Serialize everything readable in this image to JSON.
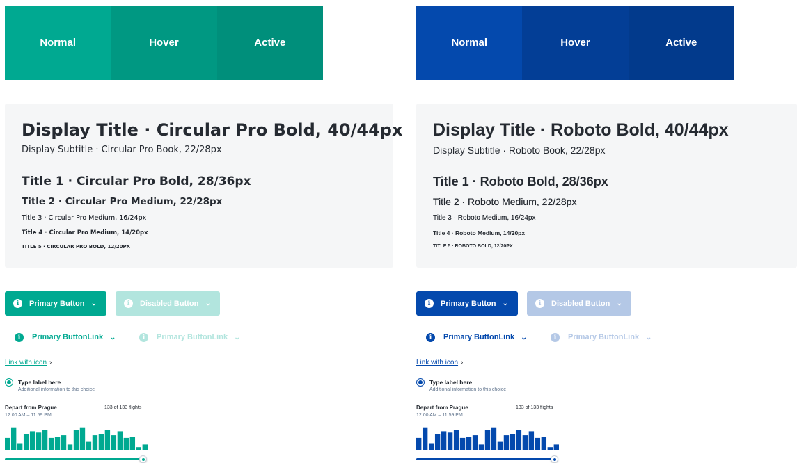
{
  "themes": [
    {
      "id": "green",
      "colors": {
        "normal": "#00a991",
        "hover": "#009882",
        "active": "#008f7b",
        "disabled": "#b2e5de",
        "text": "#00a991",
        "muted": "#b2e5de"
      },
      "swatches": {
        "normal": "Normal",
        "hover": "Hover",
        "active": "Active"
      },
      "typography": {
        "display": "Display Title · Circular Pro Bold, 40/44px",
        "subtitle": "Display Subtitle · Circular Pro Book, 22/28px",
        "title1": "Title 1 · Circular Pro Bold, 28/36px",
        "title2": "Title 2 · Circular Pro Medium, 22/28px",
        "title3": "Title 3 · Circular Pro Medium, 16/24px",
        "title4": "Title 4 · Circular Pro Medium, 14/20px",
        "title5": "TITLE 5 · CIRCULAR PRO BOLD, 12/20PX"
      },
      "buttons": {
        "primary": "Primary Button",
        "disabled": "Disabled Button",
        "primary_link": "Primary ButtonLink",
        "disabled_link": "Primary ButtonLink"
      },
      "link": "Link with icon",
      "radio": {
        "label": "Type label here",
        "help": "Additional information to this choice",
        "checked": true
      },
      "slider": {
        "title": "Depart from Prague",
        "time": "12:00 AM – 11:59 PM",
        "count": "133 of 133 flights",
        "value": 1.0
      }
    },
    {
      "id": "blue",
      "colors": {
        "normal": "#0449ad",
        "hover": "#033e96",
        "active": "#023a8c",
        "disabled": "#b4c8e6",
        "text": "#0449ad",
        "muted": "#b4c8e6"
      },
      "swatches": {
        "normal": "Normal",
        "hover": "Hover",
        "active": "Active"
      },
      "typography": {
        "display": "Display Title · Roboto Bold, 40/44px",
        "subtitle": "Display Subtitle · Roboto Book, 22/28px",
        "title1": "Title 1 · Roboto Bold, 28/36px",
        "title2": "Title 2 · Roboto Medium, 22/28px",
        "title3": "Title 3 · Roboto Medium, 16/24px",
        "title4": "Title 4 · Roboto Medium, 14/20px",
        "title5": "TITLE 5 · ROBOTO BOLD, 12/20PX"
      },
      "buttons": {
        "primary": "Primary Button",
        "disabled": "Disabled Button",
        "primary_link": "Primary ButtonLink",
        "disabled_link": "Primary ButtonLink"
      },
      "link": "Link with icon",
      "radio": {
        "label": "Type label here",
        "help": "Additional information to this choice",
        "checked": true
      },
      "slider": {
        "title": "Depart from Prague",
        "time": "12:00 AM – 11:59 PM",
        "count": "133 of 133 flights",
        "value": 1.0
      }
    }
  ],
  "histogram": [
    0.45,
    0.85,
    0.25,
    0.6,
    0.7,
    0.65,
    0.75,
    0.45,
    0.5,
    0.55,
    0.2,
    0.75,
    0.85,
    0.3,
    0.55,
    0.6,
    0.75,
    0.55,
    0.7,
    0.45,
    0.5,
    0.1,
    0.2
  ],
  "icons": {
    "info": "info-icon",
    "chevron": "chevron-down-icon",
    "link_chevron": "chevron-right-icon"
  }
}
